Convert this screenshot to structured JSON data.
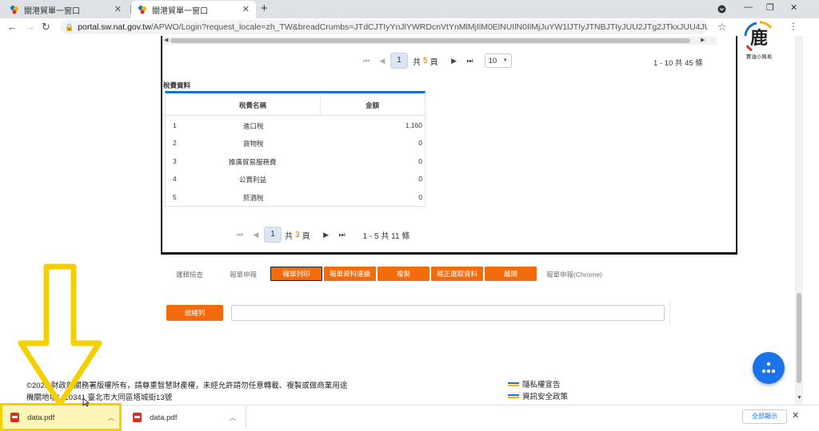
{
  "browser": {
    "tabs": [
      {
        "title": "關港貿單一窗口",
        "active": false
      },
      {
        "title": "關港貿單一窗口",
        "active": true
      }
    ],
    "url_host": "portal.sw.nat.gov.tw",
    "url_rest": "/APWO/Login?request_locale=zh_TW&breadCrumbs=JTdCJTIyYnJlYWRDcnVtYnMlMjIlM0ElNUIlN0IlMjJuYW1lJTIyJTNBJTIyJUU2JTg2JTkxJUU4JUFEJTg5JUU5JTgwJ...",
    "icons": [
      "back-icon",
      "forward-icon",
      "reload-icon",
      "star-icon",
      "menu-icon"
    ]
  },
  "main_pager": {
    "current": "1",
    "of_prefix": "共",
    "total_pages": "5",
    "of_suffix": "頁",
    "page_size": "10",
    "summary": "1 - 10 共 45 條"
  },
  "fee": {
    "section_title": "稅費資料",
    "columns": [
      "稅費名稱",
      "金額"
    ],
    "rows": [
      {
        "no": "1",
        "name": "進口稅",
        "amount": "1,160"
      },
      {
        "no": "2",
        "name": "貨物稅",
        "amount": "0"
      },
      {
        "no": "3",
        "name": "推廣貿易服務費",
        "amount": "0"
      },
      {
        "no": "4",
        "name": "公賣利益",
        "amount": "0"
      },
      {
        "no": "5",
        "name": "菸酒稅",
        "amount": "0"
      }
    ],
    "pager": {
      "current": "1",
      "of_prefix": "共",
      "total_pages": "3",
      "of_suffix": "頁",
      "summary": "1 - 5 共 11 條"
    }
  },
  "actions": {
    "link_check": "邏輯檢查",
    "link_declare": "報單申報",
    "print": "報單列印",
    "print_cont": "報單資料連續",
    "copy": "複製",
    "correct": "補正選取資料",
    "leave": "離開",
    "chrome_declare": "報單申報(Chrome)",
    "complete": "就緒列"
  },
  "footer": {
    "copyright": "©2020 財政部關務署版權所有，請尊重智慧財產權，未經允許請勿任意轉載、複製或做商業用途",
    "address": "機關地址：10341 臺北市大同區塔城街13號",
    "privacy": "隱私權宣告",
    "security": "資訊安全政策"
  },
  "downloads": [
    {
      "name": "data.pdf"
    },
    {
      "name": "data.pdf"
    }
  ],
  "shelf": {
    "show_all": "全部顯示"
  },
  "logo_text": "賣油小貿易",
  "colors": {
    "accent_orange": "#f26c0d",
    "accent_blue": "#1a73c8",
    "highlight_yellow": "#f5d000"
  }
}
